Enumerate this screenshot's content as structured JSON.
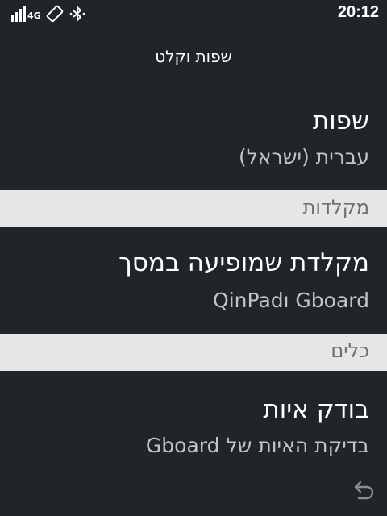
{
  "status_bar": {
    "network_label": "4G",
    "time": "20:12",
    "icons": [
      "signal-icon",
      "screen-rotate-icon",
      "bluetooth-icon"
    ]
  },
  "header": {
    "title": "שפות וקלט"
  },
  "preferences": {
    "languages": {
      "title": "שפות",
      "summary": "עברית (ישראל)"
    },
    "keyboards_category": "מקלדות",
    "on_screen_keyboard": {
      "title": "מקלדת שמופיעה במסך",
      "summary": "QinPadו Gboard"
    },
    "tools_category": "כלים",
    "spell_checker": {
      "title": "בודק איות",
      "summary": "בדיקת האיות של Gboard"
    }
  },
  "navigation": {
    "back_icon": "back-arrow-icon"
  },
  "colors": {
    "background": "#212529",
    "category_background": "#e6e6e6",
    "category_text": "#6f6f6f",
    "primary_text": "#ffffff",
    "secondary_text": "#c4c4c4"
  }
}
